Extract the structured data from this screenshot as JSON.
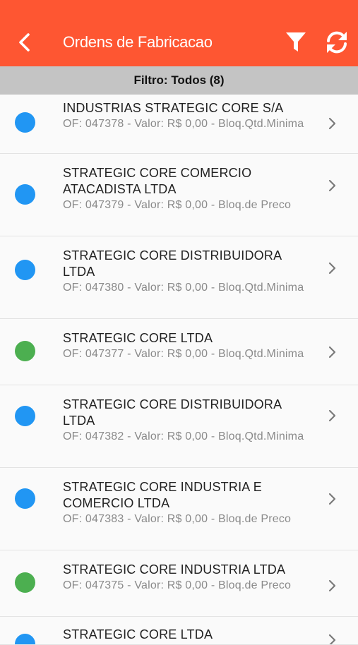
{
  "header": {
    "title": "Ordens de Fabricacao",
    "back_icon": "chevron-left-icon",
    "filter_icon": "filter-icon",
    "refresh_icon": "refresh-icon"
  },
  "filter_bar": {
    "label": "Filtro: Todos (8)"
  },
  "colors": {
    "header": "#fe5632",
    "status_blue": "#2196f3",
    "status_green": "#4caf50"
  },
  "orders": [
    {
      "name": "INDUSTRIAS STRATEGIC CORE S/A",
      "detail": "OF: 047378 - Valor: R$ 0,00 - Bloq.Qtd.Minima",
      "status": "blue"
    },
    {
      "name": "STRATEGIC CORE COMERCIO ATACADISTA LTDA",
      "detail": "OF: 047379 - Valor: R$ 0,00 - Bloq.de Preco",
      "status": "blue"
    },
    {
      "name": "STRATEGIC CORE DISTRIBUIDORA LTDA",
      "detail": "OF: 047380 - Valor: R$ 0,00 - Bloq.Qtd.Minima",
      "status": "blue"
    },
    {
      "name": "STRATEGIC CORE LTDA",
      "detail": "OF: 047377 - Valor: R$ 0,00 - Bloq.Qtd.Minima",
      "status": "green"
    },
    {
      "name": "STRATEGIC CORE DISTRIBUIDORA LTDA",
      "detail": "OF: 047382 - Valor: R$ 0,00 - Bloq.Qtd.Minima",
      "status": "blue"
    },
    {
      "name": "STRATEGIC CORE INDUSTRIA E COMERCIO LTDA",
      "detail": "OF: 047383 - Valor: R$ 0,00 - Bloq.de Preco",
      "status": "blue"
    },
    {
      "name": "STRATEGIC CORE INDUSTRIA LTDA",
      "detail": "OF: 047375 - Valor: R$ 0,00 - Bloq.de Preco",
      "status": "green"
    },
    {
      "name": "STRATEGIC CORE LTDA",
      "detail": "",
      "status": "blue"
    }
  ]
}
